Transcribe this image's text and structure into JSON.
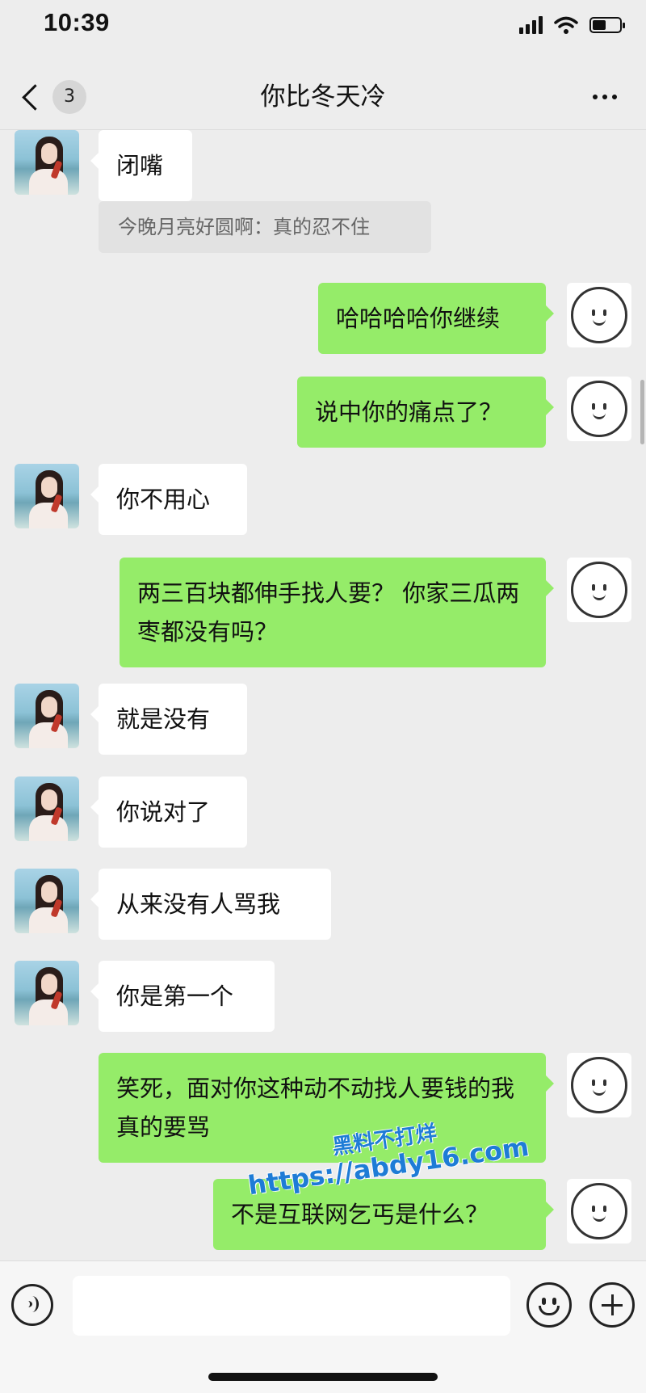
{
  "status_bar": {
    "time": "10:39",
    "battery_level": 0.45
  },
  "nav": {
    "unread_count": "3",
    "title": "你比冬天冷"
  },
  "messages": [
    {
      "side": "in",
      "text": "闭嘴",
      "quote": "今晚月亮好圆啊：真的忍不住"
    },
    {
      "side": "out",
      "text": "哈哈哈哈你继续"
    },
    {
      "side": "out",
      "text": "说中你的痛点了？"
    },
    {
      "side": "in",
      "text": "你不用心"
    },
    {
      "side": "out",
      "text": "两三百块都伸手找人要？ 你家三瓜两枣都没有吗？"
    },
    {
      "side": "in",
      "text": "就是没有"
    },
    {
      "side": "in",
      "text": "你说对了"
    },
    {
      "side": "in",
      "text": "从来没有人骂我"
    },
    {
      "side": "in",
      "text": "你是第一个"
    },
    {
      "side": "out",
      "text": "笑死，面对你这种动不动找人要钱的我真的要骂"
    },
    {
      "side": "out",
      "text": "不是互联网乞丐是什么？"
    }
  ],
  "watermark": {
    "line1": "黑料不打烊",
    "line2": "https://abdy16.com"
  },
  "colors": {
    "background": "#ededed",
    "outgoing_bubble": "#95ec69",
    "incoming_bubble": "#ffffff"
  },
  "icons": {
    "back": "chevron-left-icon",
    "more": "more-dots-icon",
    "voice": "voice-icon",
    "emoji": "emoji-icon",
    "plus": "plus-icon"
  }
}
